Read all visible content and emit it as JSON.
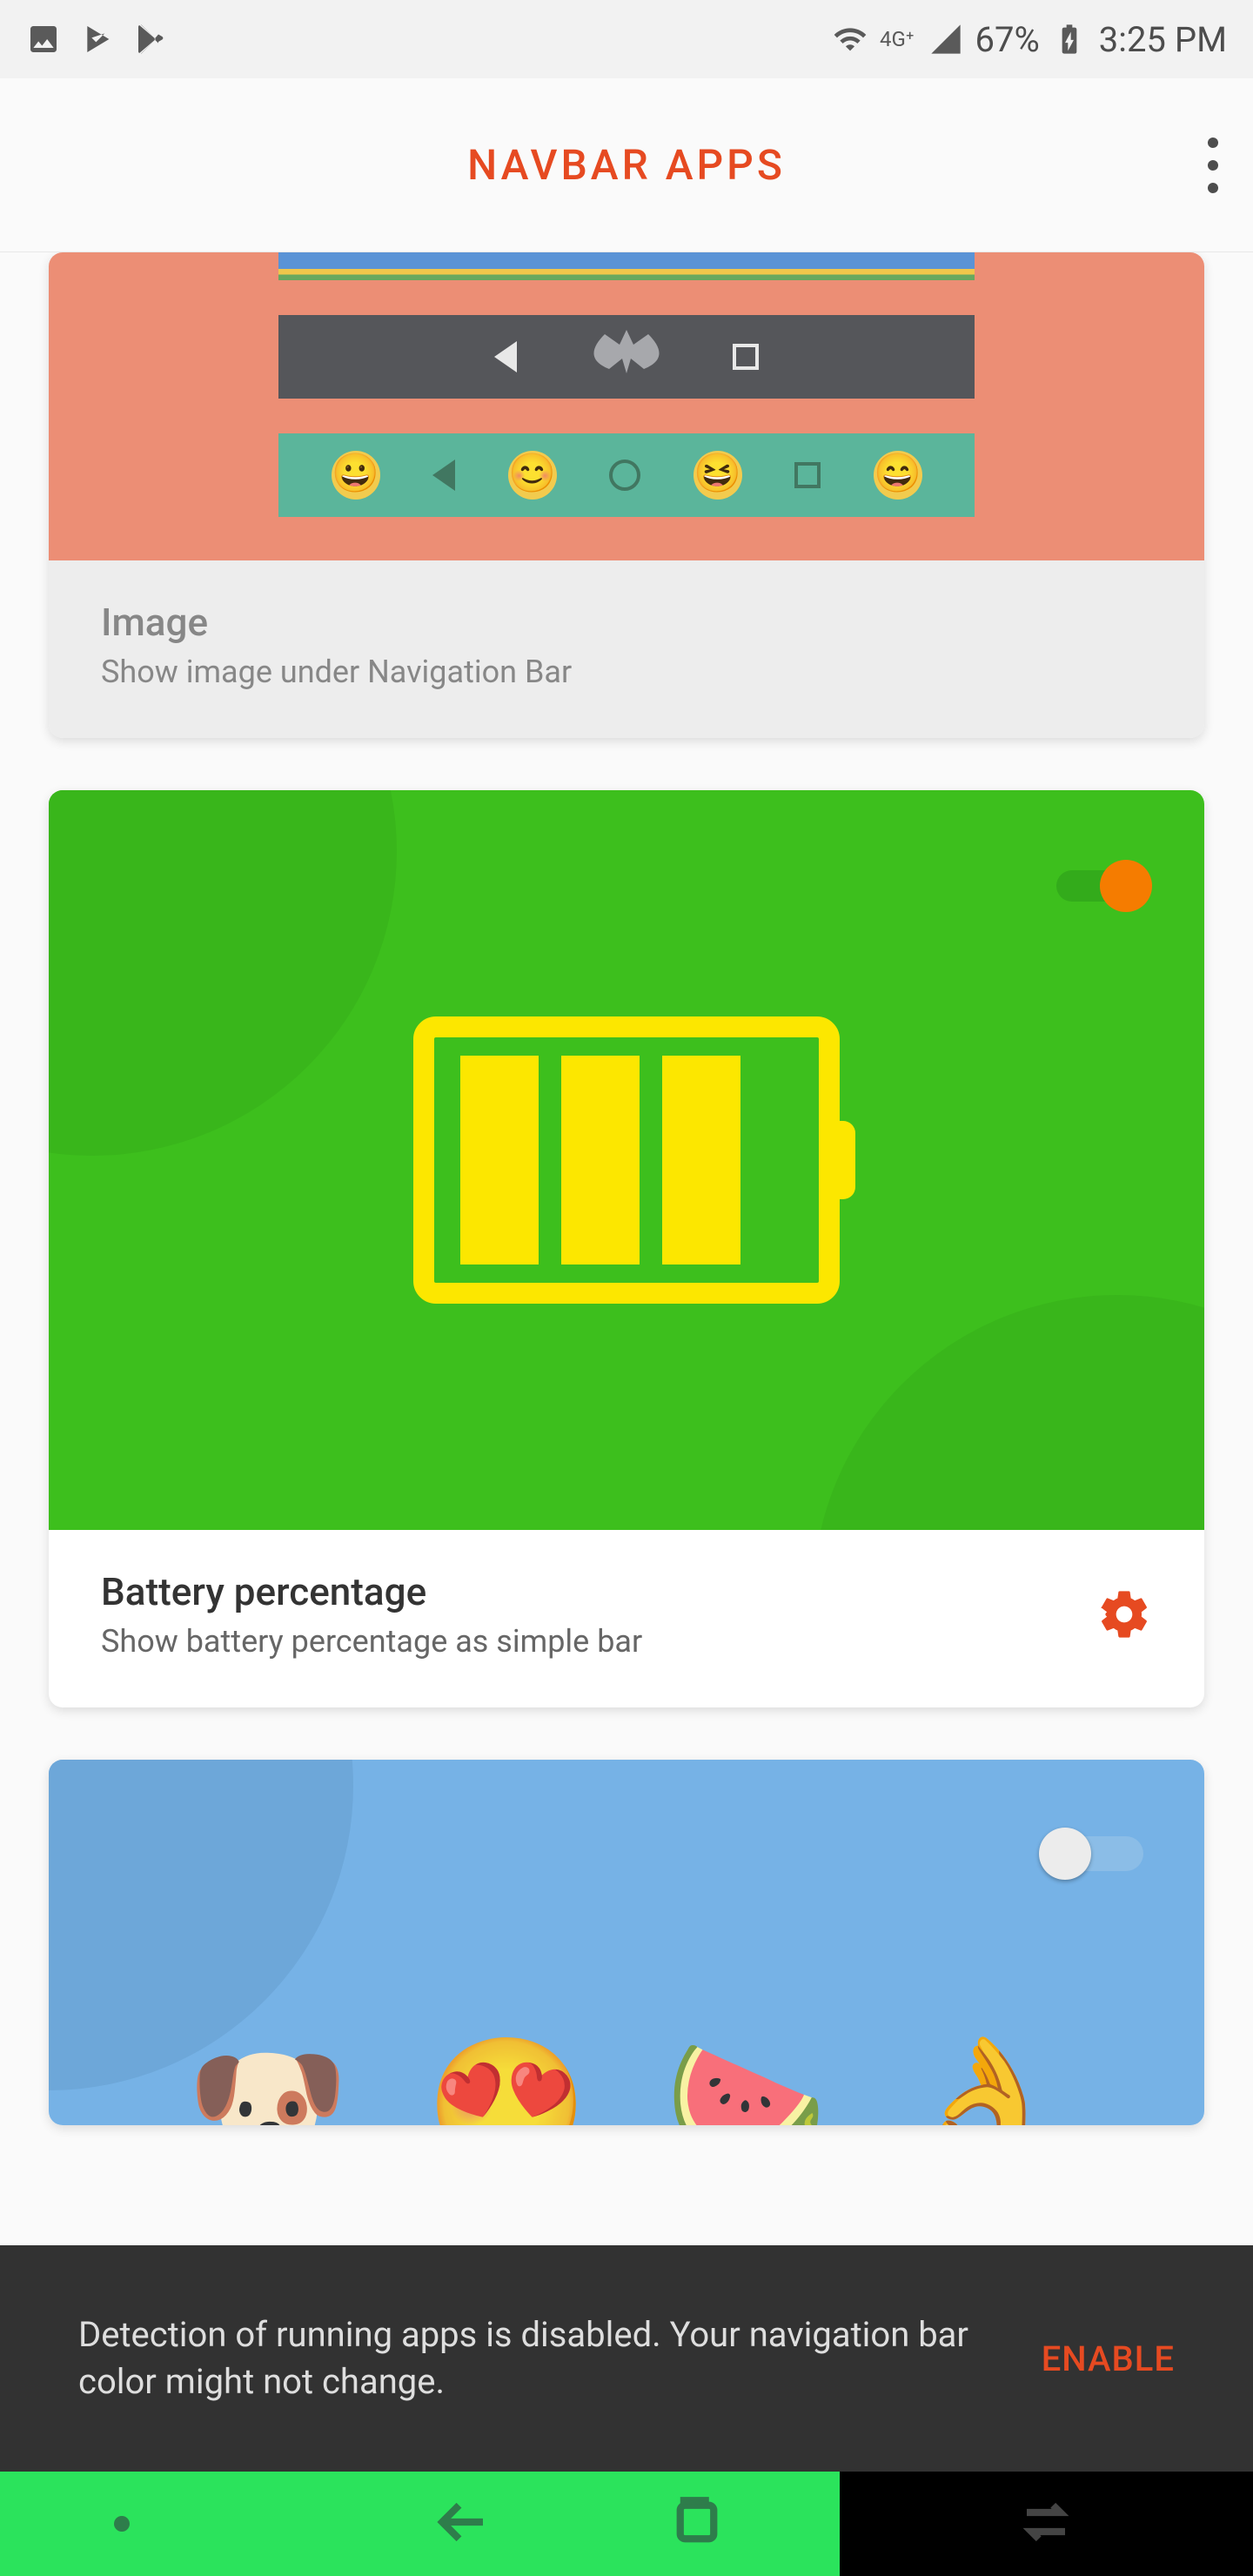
{
  "status": {
    "battery": "67%",
    "time": "3:25 PM",
    "network": "4G"
  },
  "app": {
    "title": "NAVBAR APPS"
  },
  "cards": {
    "image": {
      "title": "Image",
      "subtitle": "Show image under Navigation Bar"
    },
    "battery": {
      "title": "Battery percentage",
      "subtitle": "Show battery percentage as simple bar",
      "toggle": true
    },
    "emoji": {
      "toggle": false
    }
  },
  "snackbar": {
    "text": "Detection of running apps is disabled. Your navigation bar color might not change.",
    "action": "ENABLE"
  }
}
